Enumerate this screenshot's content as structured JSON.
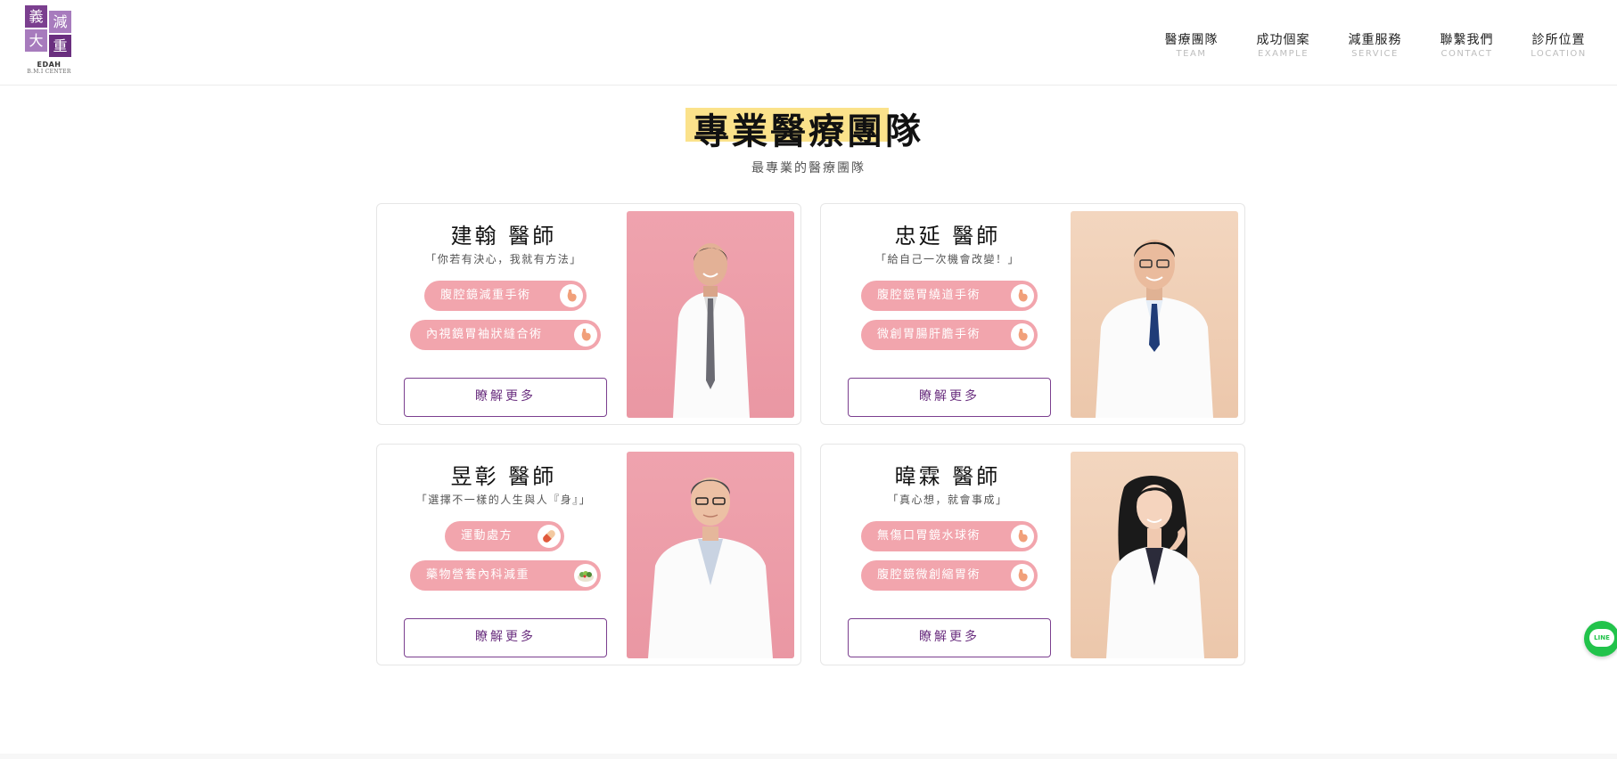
{
  "brand": {
    "chars": [
      "義",
      "減",
      "大",
      "重"
    ],
    "en": "EDAH",
    "sub": "B.M.I CENTER",
    "color": "#7b3f8f"
  },
  "nav": [
    {
      "zh": "醫療團隊",
      "en": "TEAM"
    },
    {
      "zh": "成功個案",
      "en": "EXAMPLE"
    },
    {
      "zh": "減重服務",
      "en": "SERVICE"
    },
    {
      "zh": "聯繫我們",
      "en": "CONTACT"
    },
    {
      "zh": "診所位置",
      "en": "LOCATION"
    }
  ],
  "hero": {
    "title": "專業醫療團隊",
    "subtitle": "最專業的醫療團隊",
    "highlight_color": "#fbe28b"
  },
  "doctors": [
    {
      "name": "建翰 醫師",
      "quote": "「你若有決心，我就有方法」",
      "tags": [
        {
          "label": "腹腔鏡減重手術",
          "icon": "stomach-icon"
        },
        {
          "label": "內視鏡胃袖狀縫合術",
          "icon": "stomach-icon"
        }
      ],
      "button": "瞭解更多",
      "photo_bg": "pink"
    },
    {
      "name": "忠延 醫師",
      "quote": "「給自己一次機會改變！」",
      "tags": [
        {
          "label": "腹腔鏡胃繞道手術",
          "icon": "stomach-icon"
        },
        {
          "label": "微創胃腸肝膽手術",
          "icon": "stomach-icon"
        }
      ],
      "button": "瞭解更多",
      "photo_bg": "beige"
    },
    {
      "name": "昱彰 醫師",
      "quote": "「選擇不一樣的人生與人『身』」",
      "tags": [
        {
          "label": "運動處方",
          "icon": "pill-icon"
        },
        {
          "label": "藥物營養內科減重",
          "icon": "salad-icon"
        }
      ],
      "button": "瞭解更多",
      "photo_bg": "pink"
    },
    {
      "name": "暐霖 醫師",
      "quote": "「真心想，就會事成」",
      "tags": [
        {
          "label": "無傷口胃鏡水球術",
          "icon": "stomach-icon"
        },
        {
          "label": "腹腔鏡微創縮胃術",
          "icon": "stomach-icon"
        }
      ],
      "button": "瞭解更多",
      "photo_bg": "beige"
    }
  ],
  "line": {
    "label": "LINE",
    "color": "#22c34b"
  },
  "colors": {
    "tag": "#f2a5ad",
    "button_border": "#7b3f8f",
    "pink_photo": "#efa3ae",
    "beige_photo": "#f3d6bf"
  }
}
